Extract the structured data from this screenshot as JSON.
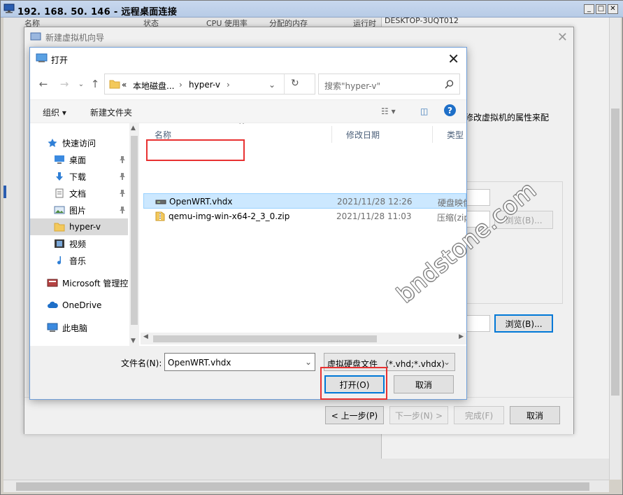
{
  "rdp": {
    "title": "192. 168. 50. 146 - 远程桌面连接",
    "remote_right_title": "DESKTOP-3UQT012",
    "columns": [
      "名称",
      "状态",
      "CPU 使用率",
      "分配的内存",
      "运行时"
    ]
  },
  "wizard": {
    "title": "新建虚拟机向导",
    "desc": "修改虚拟机的属性来配",
    "browse1": "浏览(B)...",
    "browse2": "浏览(B)...",
    "prev": "< 上一步(P)",
    "next": "下一步(N) >",
    "finish": "完成(F)",
    "cancel": "取消"
  },
  "open": {
    "title": "打开",
    "address": {
      "prefix": "«",
      "seg1": "本地磁盘...",
      "seg2": "hyper-v"
    },
    "search_placeholder": "搜索\"hyper-v\"",
    "toolbar": {
      "organize": "组织 ▾",
      "new_folder": "新建文件夹"
    },
    "nav": [
      {
        "label": "快速访问",
        "icon": "star-icon"
      },
      {
        "label": "桌面",
        "icon": "desktop-icon",
        "pinned": true
      },
      {
        "label": "下载",
        "icon": "download-icon",
        "pinned": true
      },
      {
        "label": "文档",
        "icon": "document-icon",
        "pinned": true
      },
      {
        "label": "图片",
        "icon": "picture-icon",
        "pinned": true
      },
      {
        "label": "hyper-v",
        "icon": "folder-icon",
        "selected": true
      },
      {
        "label": "视频",
        "icon": "video-icon"
      },
      {
        "label": "音乐",
        "icon": "music-icon"
      },
      {
        "label": "Microsoft 管理控",
        "icon": "mmc-icon"
      },
      {
        "label": "OneDrive",
        "icon": "cloud-icon"
      },
      {
        "label": "此电脑",
        "icon": "computer-icon"
      }
    ],
    "columns": {
      "name": "名称",
      "date": "修改日期",
      "type": "类型"
    },
    "files": [
      {
        "name": "OpenWRT.vhdx",
        "date": "2021/11/28 12:26",
        "type": "硬盘映像",
        "selected": true
      },
      {
        "name": "qemu-img-win-x64-2_3_0.zip",
        "date": "2021/11/28 11:03",
        "type": "压缩(zip"
      }
    ],
    "filename_label": "文件名(N):",
    "filename_value": "OpenWRT.vhdx",
    "filetype_value": "虚拟硬盘文件 （*.vhd;*.vhdx)",
    "open_btn": "打开(O)",
    "cancel_btn": "取消"
  },
  "watermark": "bndstone.com",
  "colors": {
    "accent": "#0078d7",
    "highlight": "#e83131",
    "selection": "#cce8ff"
  }
}
